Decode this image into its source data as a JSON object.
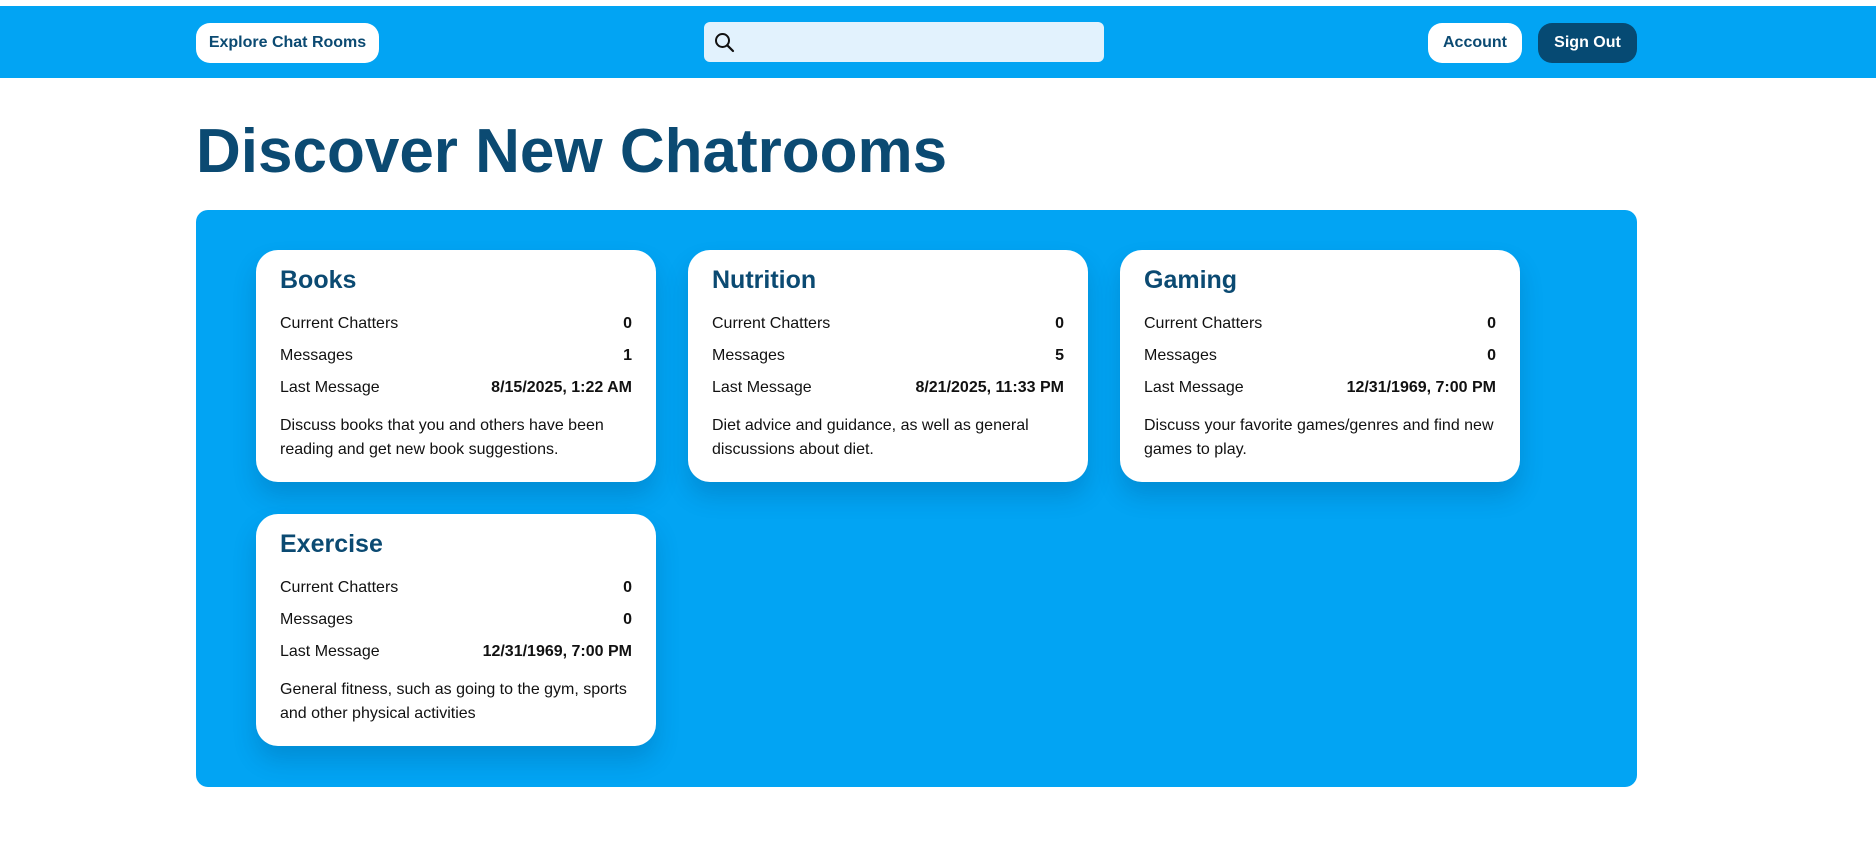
{
  "header": {
    "explore_label": "Explore Chat Rooms",
    "search_placeholder": "",
    "account_label": "Account",
    "signout_label": "Sign Out"
  },
  "page_title": "Discover New Chatrooms",
  "labels": {
    "current_chatters": "Current Chatters",
    "messages": "Messages",
    "last_message": "Last Message"
  },
  "rooms": [
    {
      "name": "Books",
      "current_chatters": "0",
      "messages": "1",
      "last_message": "8/15/2025, 1:22 AM",
      "description": "Discuss books that you and others have been reading and get new book suggestions."
    },
    {
      "name": "Nutrition",
      "current_chatters": "0",
      "messages": "5",
      "last_message": "8/21/2025, 11:33 PM",
      "description": "Diet advice and guidance, as well as general discussions about diet."
    },
    {
      "name": "Gaming",
      "current_chatters": "0",
      "messages": "0",
      "last_message": "12/31/1969, 7:00 PM",
      "description": "Discuss your favorite games/genres and find new games to play."
    },
    {
      "name": "Exercise",
      "current_chatters": "0",
      "messages": "0",
      "last_message": "12/31/1969, 7:00 PM",
      "description": "General fitness, such as going to the gym, sports and other physical activities"
    }
  ],
  "colors": {
    "brand_blue": "#02a4f3",
    "dark_navy": "#0b4a72",
    "signout_bg": "#064a73",
    "search_bg": "#e2f2fd"
  },
  "icons": {
    "search": "search-icon"
  }
}
